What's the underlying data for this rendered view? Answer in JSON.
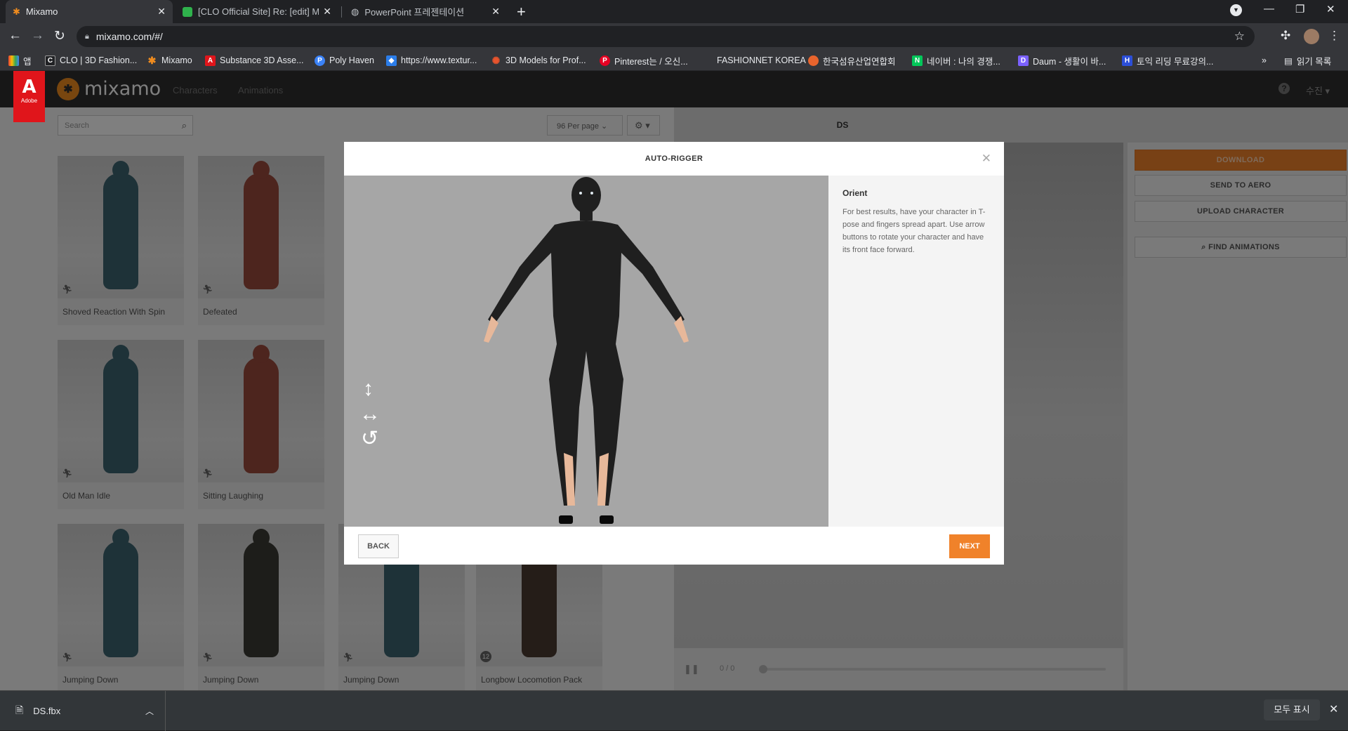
{
  "browser": {
    "tabs": [
      {
        "title": "Mixamo",
        "active": true
      },
      {
        "title": "[CLO Official Site] Re: [edit] Mix",
        "active": false
      },
      {
        "title": "PowerPoint 프레젠테이션",
        "active": false
      }
    ],
    "url": "mixamo.com/#/",
    "bookmarks": [
      {
        "label": "앱",
        "icon": "apps-icon",
        "color": "#ea4335"
      },
      {
        "label": "CLO | 3D Fashion...",
        "icon": "clo-icon",
        "color": "#202124"
      },
      {
        "label": "Mixamo",
        "icon": "mixamo-icon",
        "color": "#f08c1e"
      },
      {
        "label": "Substance 3D Asse...",
        "icon": "adobe-icon",
        "color": "#e0151b"
      },
      {
        "label": "Poly Haven",
        "icon": "polyhaven-icon",
        "color": "#3b82f6"
      },
      {
        "label": "https://www.textur...",
        "icon": "cube-icon",
        "color": "#2b7de9"
      },
      {
        "label": "3D Models for Prof...",
        "icon": "turbosquid-icon",
        "color": "#e8542d"
      },
      {
        "label": "Pinterest는 / 오신...",
        "icon": "pinterest-icon",
        "color": "#e60023"
      },
      {
        "label": "FASHIONNET KOREA",
        "icon": "",
        "color": ""
      },
      {
        "label": "한국섬유산업연합회",
        "icon": "kofoti-icon",
        "color": "#e8642d"
      },
      {
        "label": "네이버 : 나의 경쟁...",
        "icon": "naver-icon",
        "color": "#03c75a"
      },
      {
        "label": "Daum - 생활이 바...",
        "icon": "daum-icon",
        "color": "#7b61ff"
      },
      {
        "label": "토익 리딩 무료강의...",
        "icon": "h-icon",
        "color": "#2c4fd8"
      }
    ],
    "reading_list": "읽기 목록",
    "more": "»"
  },
  "mixamo": {
    "adobe_label": "Adobe",
    "logo": "mixamo",
    "nav": [
      "Characters",
      "Animations"
    ],
    "user": "수진",
    "search_placeholder": "Search",
    "per_page": "96 Per page",
    "character_name": "DS",
    "cards": [
      {
        "name": "Shoved Reaction With Spin",
        "color": "#3d6470"
      },
      {
        "name": "Defeated",
        "color": "#9a4a3c"
      },
      {
        "name": "Old Man Idle",
        "color": "#3d6470"
      },
      {
        "name": "Sitting Laughing",
        "color": "#9a4a3c"
      },
      {
        "name": "Jumping Down",
        "color": "#3d6470"
      },
      {
        "name": "Jumping Down",
        "color": "#3b3b34"
      },
      {
        "name": "Jumping Down",
        "color": "#3d6470"
      },
      {
        "name": "Longbow Locomotion Pack",
        "color": "#4a3a30",
        "badge": "12"
      }
    ],
    "side_buttons": {
      "download": "DOWNLOAD",
      "send_to_aero": "SEND TO AERO",
      "upload": "UPLOAD CHARACTER",
      "find": "FIND ANIMATIONS"
    },
    "timeline": "0 / 0",
    "accent": "#f0822a"
  },
  "modal": {
    "title": "AUTO-RIGGER",
    "heading": "Orient",
    "text": "For best results, have your character in T-pose and fingers spread apart. Use arrow buttons to rotate your character and have its front face forward.",
    "back": "BACK",
    "next": "NEXT"
  },
  "downloads": {
    "file": "DS.fbx",
    "show_all": "모두 표시"
  }
}
